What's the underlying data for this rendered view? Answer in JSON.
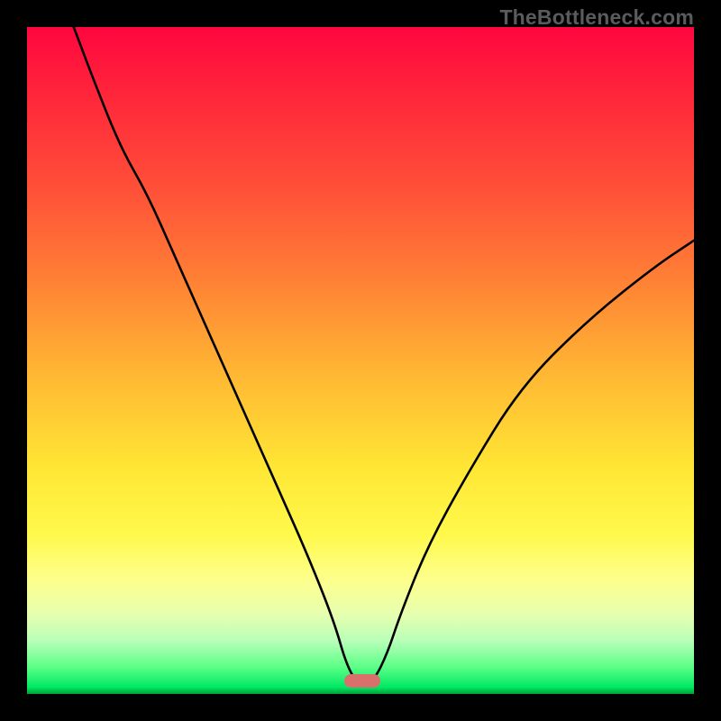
{
  "watermark": {
    "text": "TheBottleneck.com"
  },
  "marker": {
    "left_pct": 47.5,
    "top_pct": 97.0,
    "width_pct": 5.5,
    "height_pct": 2.0,
    "color": "#d9706b"
  },
  "chart_data": {
    "type": "line",
    "title": "",
    "xlabel": "",
    "ylabel": "",
    "xlim": [
      0,
      100
    ],
    "ylim": [
      0,
      100
    ],
    "grid": false,
    "legend": false,
    "series": [
      {
        "name": "bottleneck-curve",
        "x": [
          7,
          10,
          14,
          18,
          22,
          26,
          30,
          34,
          38,
          42,
          46,
          48,
          50,
          52,
          54,
          56,
          60,
          66,
          74,
          84,
          94,
          100
        ],
        "y": [
          100,
          92,
          82,
          75,
          66,
          57,
          48,
          39,
          30,
          21,
          11,
          4,
          1,
          2,
          6,
          12,
          22,
          33,
          46,
          56,
          64,
          68
        ]
      }
    ],
    "background_gradient": [
      {
        "pos": 0.0,
        "color": "#ff063f"
      },
      {
        "pos": 0.25,
        "color": "#ff5238"
      },
      {
        "pos": 0.52,
        "color": "#ffb733"
      },
      {
        "pos": 0.76,
        "color": "#fff94b"
      },
      {
        "pos": 0.92,
        "color": "#b9ffb9"
      },
      {
        "pos": 1.0,
        "color": "#009e3a"
      }
    ]
  },
  "colors": {
    "page_bg": "#000000",
    "curve_stroke": "#000000",
    "watermark": "#5b5b5b"
  }
}
